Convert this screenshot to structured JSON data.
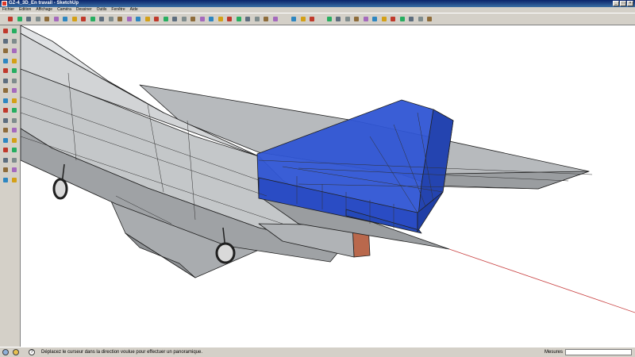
{
  "window": {
    "title": "GZ-4_3D_En travail - SketchUp",
    "app_icon": "sketchup-icon",
    "buttons": [
      "minimize-icon",
      "maximize-icon",
      "close-icon"
    ]
  },
  "menubar": {
    "items": [
      "Fichier",
      "Edition",
      "Affichage",
      "Caméra",
      "Dessiner",
      "Outils",
      "Fenêtre",
      "Aide"
    ]
  },
  "top_toolbar": {
    "icons": [
      "select-arrow-icon",
      "pencil-icon",
      "rectangle-icon",
      "circle-icon",
      "arc-icon",
      "eraser-icon",
      "paint-bucket-icon",
      "push-pull-icon",
      "move-icon",
      "rotate-icon",
      "follow-me-icon",
      "scale-icon",
      "offset-icon",
      "tape-measure-icon",
      "protractor-icon",
      "axes-icon",
      "dimension-icon",
      "text-icon",
      "3d-text-icon",
      "orbit-icon",
      "pan-icon",
      "zoom-icon",
      "zoom-window-icon",
      "zoom-extents-icon",
      "previous-view-icon",
      "next-view-icon",
      "position-camera-icon",
      "walk-icon",
      "look-around-icon",
      "section-plane-icon",
      "component-icon",
      "group-icon",
      "camera-icon",
      "iso-view-icon",
      "top-view-icon",
      "front-view-icon",
      "right-view-icon",
      "back-view-icon",
      "left-view-icon",
      "xray-icon",
      "wireframe-icon",
      "hidden-line-icon",
      "shaded-icon",
      "shaded-texture-icon",
      "monochrome-icon"
    ]
  },
  "left_toolbar": {
    "icons": [
      "select-icon",
      "component-icon",
      "paint-bucket-icon",
      "eraser-icon",
      "rectangle-icon",
      "line-icon",
      "circle-icon",
      "arc-icon",
      "polygon-icon",
      "freehand-icon",
      "move-icon",
      "push-pull-icon",
      "rotate-icon",
      "follow-me-icon",
      "scale-icon",
      "offset-icon",
      "tape-measure-icon",
      "dimension-icon",
      "protractor-icon",
      "text-icon",
      "axes-icon",
      "3d-text-icon",
      "orbit-icon",
      "pan-icon",
      "zoom-icon",
      "zoom-window-icon",
      "previous-view-icon",
      "zoom-extents-icon",
      "position-camera-icon",
      "walk-icon",
      "look-around-icon",
      "section-plane-icon"
    ]
  },
  "status_bar": {
    "icons": [
      "geo-location-icon",
      "credits-icon",
      "help-icon"
    ],
    "message": "Déplacez le curseur dans la direction voulue pour effectuer un panoramique.",
    "measures_label": "Mesures",
    "measures_value": ""
  },
  "colors": {
    "selection_blue": "#2f55d4",
    "model_gray": "#b9bcbf",
    "model_gray_dark": "#8f9295",
    "edge": "#202020",
    "brick": "#b9684c",
    "axis_red": "#c84040"
  }
}
